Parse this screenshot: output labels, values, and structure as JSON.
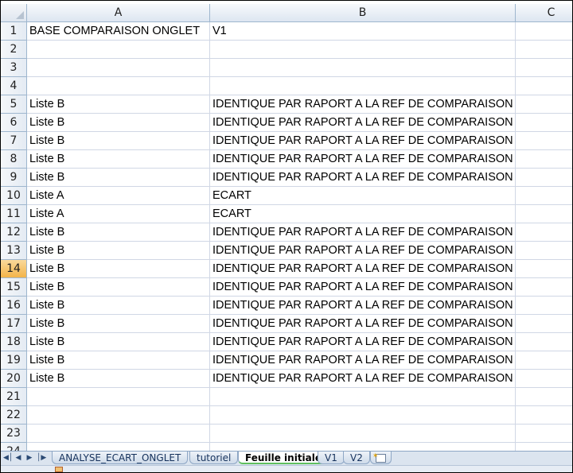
{
  "columns": [
    "A",
    "B",
    "C"
  ],
  "rows": [
    {
      "num": "1",
      "a": "BASE COMPARAISON ONGLET",
      "b": "V1"
    },
    {
      "num": "2",
      "a": "",
      "b": ""
    },
    {
      "num": "3",
      "a": "",
      "b": ""
    },
    {
      "num": "4",
      "a": "",
      "b": ""
    },
    {
      "num": "5",
      "a": "Liste B",
      "b": "IDENTIQUE PAR RAPORT A LA REF DE COMPARAISON"
    },
    {
      "num": "6",
      "a": "Liste B",
      "b": "IDENTIQUE PAR RAPORT A LA REF DE COMPARAISON"
    },
    {
      "num": "7",
      "a": "Liste B",
      "b": "IDENTIQUE PAR RAPORT A LA REF DE COMPARAISON"
    },
    {
      "num": "8",
      "a": "Liste B",
      "b": "IDENTIQUE PAR RAPORT A LA REF DE COMPARAISON"
    },
    {
      "num": "9",
      "a": "Liste B",
      "b": "IDENTIQUE PAR RAPORT A LA REF DE COMPARAISON"
    },
    {
      "num": "10",
      "a": "Liste A",
      "b": "ECART"
    },
    {
      "num": "11",
      "a": "Liste A",
      "b": "ECART"
    },
    {
      "num": "12",
      "a": "Liste B",
      "b": "IDENTIQUE PAR RAPORT A LA REF DE COMPARAISON"
    },
    {
      "num": "13",
      "a": "Liste B",
      "b": "IDENTIQUE PAR RAPORT A LA REF DE COMPARAISON"
    },
    {
      "num": "14",
      "a": "Liste B",
      "b": "IDENTIQUE PAR RAPORT A LA REF DE COMPARAISON",
      "active": true
    },
    {
      "num": "15",
      "a": "Liste B",
      "b": "IDENTIQUE PAR RAPORT A LA REF DE COMPARAISON"
    },
    {
      "num": "16",
      "a": "Liste B",
      "b": "IDENTIQUE PAR RAPORT A LA REF DE COMPARAISON"
    },
    {
      "num": "17",
      "a": "Liste B",
      "b": "IDENTIQUE PAR RAPORT A LA REF DE COMPARAISON"
    },
    {
      "num": "18",
      "a": "Liste B",
      "b": "IDENTIQUE PAR RAPORT A LA REF DE COMPARAISON"
    },
    {
      "num": "19",
      "a": "Liste B",
      "b": "IDENTIQUE PAR RAPORT A LA REF DE COMPARAISON"
    },
    {
      "num": "20",
      "a": "Liste B",
      "b": "IDENTIQUE PAR RAPORT A LA REF DE COMPARAISON"
    },
    {
      "num": "21",
      "a": "",
      "b": ""
    },
    {
      "num": "22",
      "a": "",
      "b": ""
    },
    {
      "num": "23",
      "a": "",
      "b": ""
    },
    {
      "num": "24",
      "a": "",
      "b": ""
    }
  ],
  "sheet_tabs": [
    {
      "label": "ANALYSE_ECART_ONGLET",
      "active": false
    },
    {
      "label": "tutoriel",
      "active": false
    },
    {
      "label": "Feuille initiale",
      "active": true
    },
    {
      "label": "V1",
      "active": false
    },
    {
      "label": "V2",
      "active": false
    }
  ],
  "nav_icons": [
    "first-sheet-icon",
    "prev-sheet-icon",
    "next-sheet-icon",
    "last-sheet-icon"
  ],
  "new_sheet_icon": "insert-sheet-icon",
  "colors": {
    "header_border": "#9eb6ce",
    "gridline": "#d0d7e5",
    "active_row_header": "#f3b449",
    "active_tab_underline": "#5fbf5f"
  }
}
